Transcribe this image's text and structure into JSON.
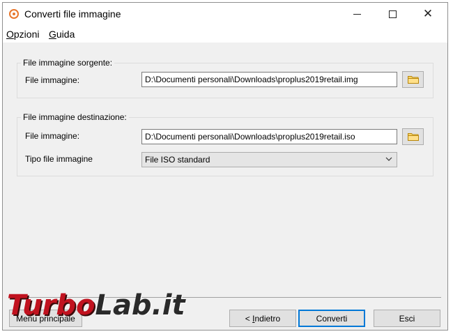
{
  "window": {
    "title": "Converti file immagine",
    "icon": "disc-icon"
  },
  "menu": {
    "items": [
      {
        "label_acc": "O",
        "label_rest": "pzioni"
      },
      {
        "label_acc": "G",
        "label_rest": "uida"
      }
    ]
  },
  "source_group": {
    "legend": "File immagine sorgente:",
    "file_label": "File immagine:",
    "file_value": "D:\\Documenti personali\\Downloads\\proplus2019retail.img"
  },
  "dest_group": {
    "legend": "File immagine  destinazione:",
    "file_label": "File immagine:",
    "file_value": "D:\\Documenti personali\\Downloads\\proplus2019retail.iso",
    "type_label": "Tipo file immagine",
    "type_value": "File ISO standard"
  },
  "buttons": {
    "main_menu": "Menu principale",
    "back_acc": "I",
    "back_prefix": "< ",
    "back_rest": "ndietro",
    "convert": "Converti",
    "exit": "Esci"
  },
  "watermark": {
    "part1": "Turbo",
    "part2": "Lab.it"
  },
  "colors": {
    "app_icon": "#e8762b",
    "default_button_border": "#0078d7",
    "watermark_red": "#c1121f"
  }
}
